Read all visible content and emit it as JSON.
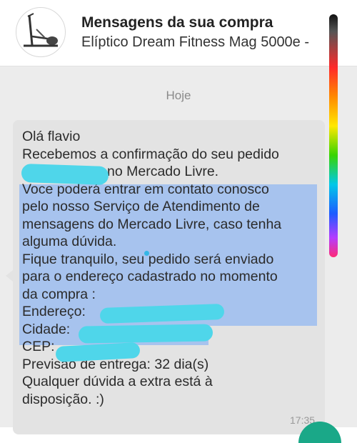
{
  "header": {
    "title": "Mensagens da sua compra",
    "subtitle": "Elíptico Dream Fitness Mag 5000e -"
  },
  "chat": {
    "day_label": "Hoje",
    "message": {
      "lines": [
        "Olá flavio",
        "Recebemos a confirmação do seu pedido",
        "no Mercado Livre.",
        "Voce poderá entrar em contato conosco",
        "pelo nosso Serviço de Atendimento de",
        "mensagens do Mercado Livre, caso tenha",
        "alguma dúvida.",
        "Fique tranquilo, seu pedido será enviado",
        "para o endereço cadastrado no momento",
        "da compra :",
        "Endereço:",
        "Cidade:",
        "CEP:",
        "Previsão de entrega: 32 dia(s)",
        "Qualquer dúvida a extra está à",
        "disposição. :)"
      ],
      "time": "17:35"
    }
  },
  "colors": {
    "highlight": "#a7c3ee",
    "redaction": "#4fd6ea",
    "bubble": "#e3e3e3",
    "fab": "#1aa888"
  }
}
